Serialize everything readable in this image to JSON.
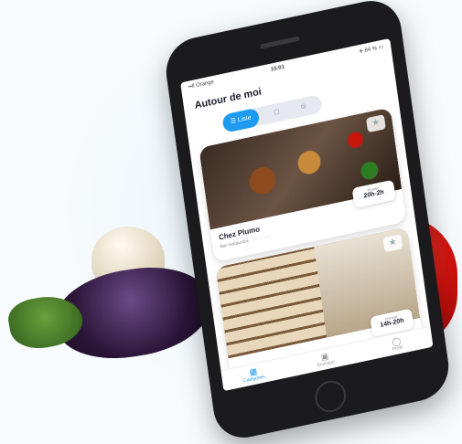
{
  "status_bar": {
    "carrier": "••ll Orange",
    "time": "15:01",
    "battery": "✈ 84 % ▭"
  },
  "header": {
    "title": "Autour de moi"
  },
  "view_toggle": {
    "list_label": "Liste",
    "map_icon": "map-icon",
    "pin_icon": "pin-icon"
  },
  "cards": [
    {
      "name": "Chez Plumo",
      "description": "Bar restaurant · ···· ·· ·····",
      "hours_label": "Horaire",
      "hours": "20h-2h",
      "favorite_icon": "star-icon"
    },
    {
      "name": "",
      "description": "",
      "hours_label": "Horaire",
      "hours": "14h-20h",
      "favorite_icon": "star-icon"
    }
  ],
  "tabbar": {
    "items": [
      {
        "label": "Catégories",
        "icon": "grid-icon"
      },
      {
        "label": "Boutique",
        "icon": "cart-icon"
      },
      {
        "label": "Profil",
        "icon": "person-icon"
      }
    ]
  },
  "colors": {
    "accent": "#1e9bf0",
    "phone": "#1b1b1d",
    "background": "#f7fbfd"
  }
}
